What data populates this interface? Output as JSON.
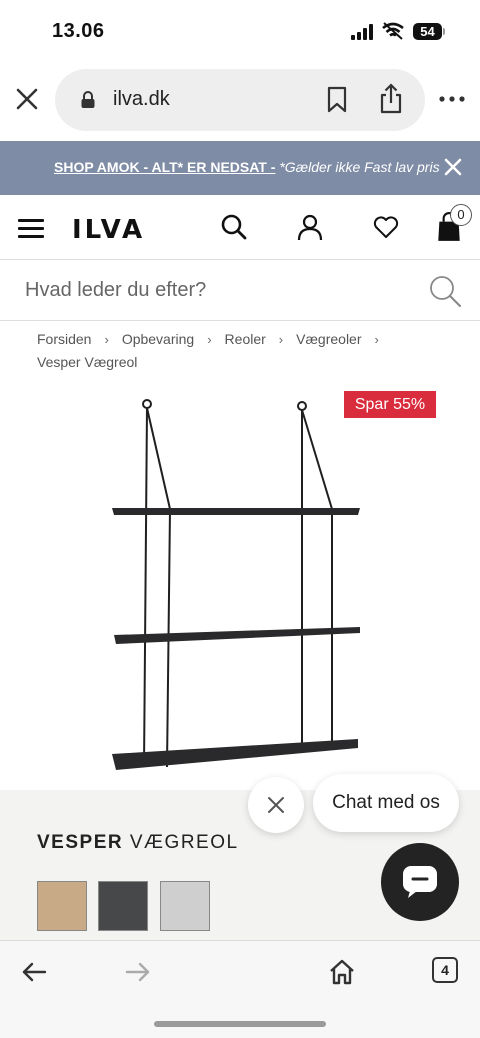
{
  "status_bar": {
    "time": "13.06",
    "battery": "54"
  },
  "browser": {
    "url": "ilva.dk",
    "open_tabs": "4"
  },
  "promo": {
    "link_text": "SHOP AMOK - ALT* ER NEDSAT -",
    "note": "*Gælder ikke Fast lav pris"
  },
  "header": {
    "logo": "ILVA",
    "cart_count": "0"
  },
  "search": {
    "placeholder": "Hvad leder du efter?"
  },
  "breadcrumb": [
    "Forsiden",
    "Opbevaring",
    "Reoler",
    "Vægreoler",
    "Vesper Vægreol"
  ],
  "product": {
    "discount_badge": "Spar 55%",
    "title_strong": "VESPER",
    "title_rest": "VÆGREOL",
    "swatch_colors": [
      "#c8aa87",
      "#46484a",
      "#cfcfcf"
    ],
    "image_colors": {
      "shelf": "#2a2a2c",
      "wire": "#1f1f1f"
    }
  },
  "chat": {
    "label": "Chat med os"
  },
  "colors": {
    "banner": "#7f8ca6",
    "badge": "#d92d3e",
    "info_bg": "#f3f3f1"
  }
}
